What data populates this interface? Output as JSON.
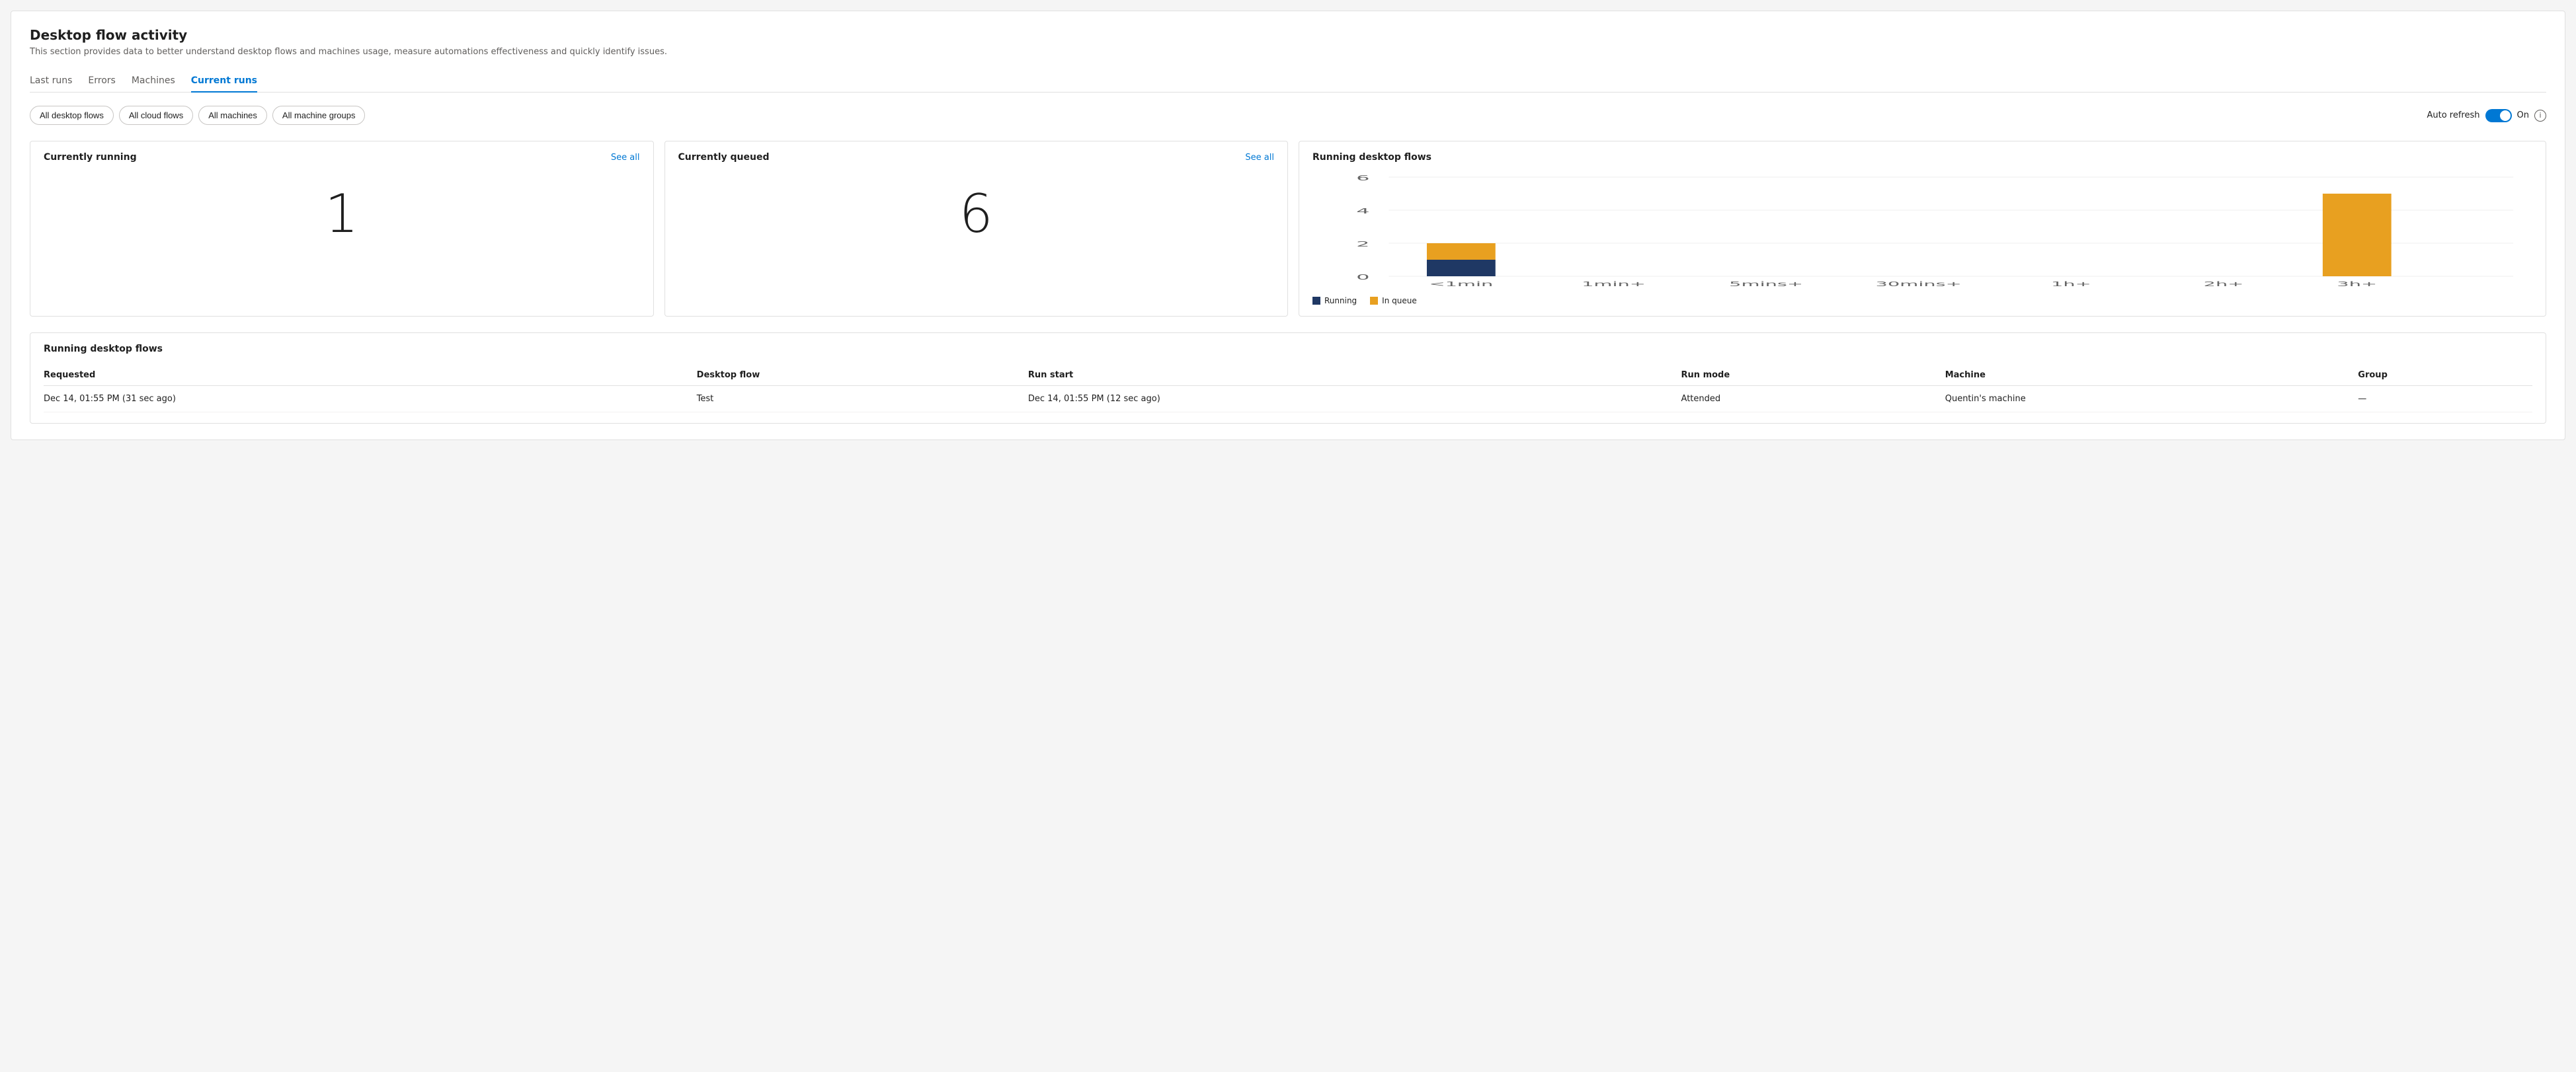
{
  "page": {
    "title": "Desktop flow activity",
    "subtitle": "This section provides data to better understand desktop flows and machines usage, measure automations effectiveness and quickly identify issues."
  },
  "tabs": [
    {
      "id": "last-runs",
      "label": "Last runs",
      "active": false
    },
    {
      "id": "errors",
      "label": "Errors",
      "active": false
    },
    {
      "id": "machines",
      "label": "Machines",
      "active": false
    },
    {
      "id": "current-runs",
      "label": "Current runs",
      "active": true
    }
  ],
  "filters": [
    {
      "id": "all-desktop-flows",
      "label": "All desktop flows"
    },
    {
      "id": "all-cloud-flows",
      "label": "All cloud flows"
    },
    {
      "id": "all-machines",
      "label": "All machines"
    },
    {
      "id": "all-machine-groups",
      "label": "All machine groups"
    }
  ],
  "autoRefresh": {
    "label": "Auto refresh",
    "statusLabel": "On",
    "enabled": true
  },
  "cards": {
    "currentlyRunning": {
      "title": "Currently running",
      "seeAllLabel": "See all",
      "value": "1"
    },
    "currentlyQueued": {
      "title": "Currently queued",
      "seeAllLabel": "See all",
      "value": "6"
    },
    "runningDesktopFlows": {
      "title": "Running desktop flows",
      "chartData": {
        "labels": [
          "<1min",
          "1min+",
          "5mins+",
          "30mins+",
          "1h+",
          "2h+",
          "3h+"
        ],
        "running": [
          1,
          0,
          0,
          0,
          0,
          0,
          0
        ],
        "inQueue": [
          1,
          0,
          0,
          0,
          0,
          0,
          5
        ],
        "yMax": 6,
        "yLabels": [
          "0",
          "2",
          "4",
          "6"
        ]
      },
      "legend": {
        "runningLabel": "Running",
        "inQueueLabel": "In queue",
        "runningColor": "#1f3864",
        "inQueueColor": "#e8a020"
      }
    }
  },
  "tableSection": {
    "title": "Running desktop flows",
    "columns": [
      {
        "id": "requested",
        "label": "Requested"
      },
      {
        "id": "desktop-flow",
        "label": "Desktop flow"
      },
      {
        "id": "run-start",
        "label": "Run start"
      },
      {
        "id": "run-mode",
        "label": "Run mode"
      },
      {
        "id": "machine",
        "label": "Machine"
      },
      {
        "id": "group",
        "label": "Group"
      }
    ],
    "rows": [
      {
        "requested": "Dec 14, 01:55 PM (31 sec ago)",
        "desktopFlow": "Test",
        "runStart": "Dec 14, 01:55 PM (12 sec ago)",
        "runMode": "Attended",
        "machine": "Quentin's machine",
        "group": "—"
      }
    ]
  }
}
